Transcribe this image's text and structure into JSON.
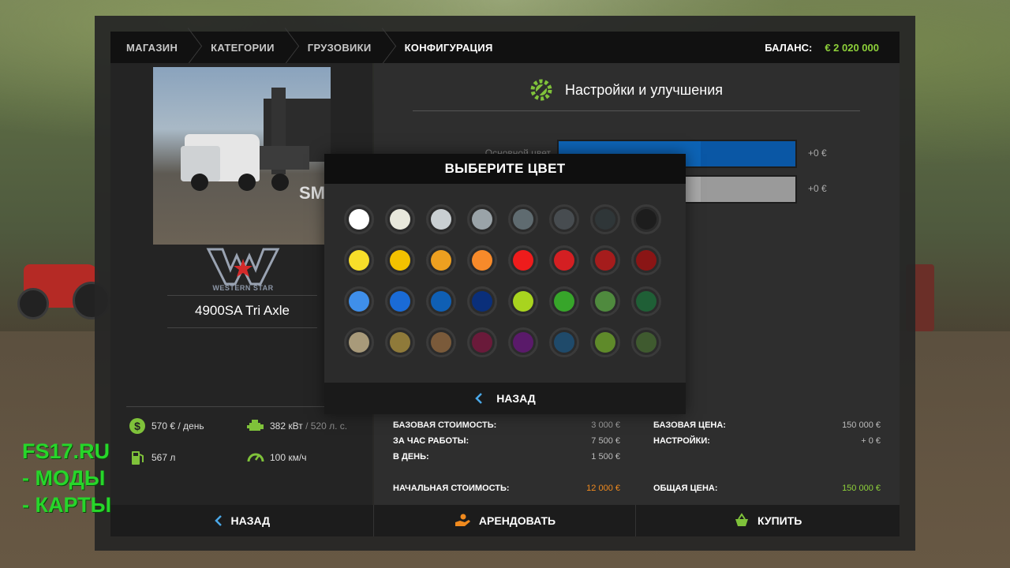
{
  "breadcrumbs": [
    "МАГАЗИН",
    "КАТЕГОРИИ",
    "ГРУЗОВИКИ",
    "КОНФИГУРАЦИЯ"
  ],
  "balance": {
    "label": "БАЛАНС:",
    "value": "€ 2 020 000"
  },
  "vehicle": {
    "brand": "WESTERN STAR",
    "name": "4900SA Tri Axle",
    "watermark": "SM"
  },
  "stats": {
    "price_per_day": "570 € / день",
    "power_kw": "382 кВт",
    "power_hp": "/ 520 л. с.",
    "capacity": "567 л",
    "speed": "100 км/ч"
  },
  "settings": {
    "title": "Настройки и улучшения",
    "rows": [
      {
        "label": "Основной цвет",
        "price": "+0 €",
        "color": "#0d63b5",
        "fill": 0.6
      },
      {
        "label": "",
        "price": "+0 €",
        "color": "#a8a8a8",
        "fill": 0.6
      }
    ]
  },
  "costs_left": {
    "base_cost_label": "БАЗОВАЯ СТОИМОСТЬ:",
    "base_cost": "3 000 €",
    "per_hour_label": "ЗА ЧАС РАБОТЫ:",
    "per_hour": "7 500 €",
    "per_day_label": "В ДЕНЬ:",
    "per_day": "1 500 €",
    "initial_label": "НАЧАЛЬНАЯ СТОИМОСТЬ:",
    "initial": "12 000 €"
  },
  "costs_right": {
    "base_price_label": "БАЗОВАЯ ЦЕНА:",
    "base_price": "150 000 €",
    "settings_label": "НАСТРОЙКИ:",
    "settings": "+ 0 €",
    "total_label": "ОБЩАЯ ЦЕНА:",
    "total": "150 000 €"
  },
  "bottom": {
    "back": "НАЗАД",
    "lease": "АРЕНДОВАТЬ",
    "buy": "КУПИТЬ"
  },
  "color_picker": {
    "title": "ВЫБЕРИТЕ ЦВЕТ",
    "back": "НАЗАД",
    "colors": [
      [
        "#ffffff",
        "#e8e8dc",
        "#c9cfd2",
        "#9aa3a8",
        "#5f6b70",
        "#474c50",
        "#2f3638",
        "#1d1d1d"
      ],
      [
        "#f7de2a",
        "#f3c200",
        "#eea020",
        "#f78a2a",
        "#ee1c1c",
        "#d41f22",
        "#a51c1c",
        "#8a1515"
      ],
      [
        "#3f8fea",
        "#1a6bd6",
        "#0f5fb4",
        "#0a2f7a",
        "#a8d41f",
        "#37a52a",
        "#4f8a3e",
        "#1f5f36"
      ],
      [
        "#a89a7a",
        "#8f7a3a",
        "#7a5a3a",
        "#6a1a3a",
        "#5a1a6a",
        "#1f4a6a",
        "#5f8a2a",
        "#3f5a2f"
      ]
    ]
  },
  "watermark_text": [
    "FS17.RU",
    " - МОДЫ",
    " - КАРТЫ"
  ]
}
